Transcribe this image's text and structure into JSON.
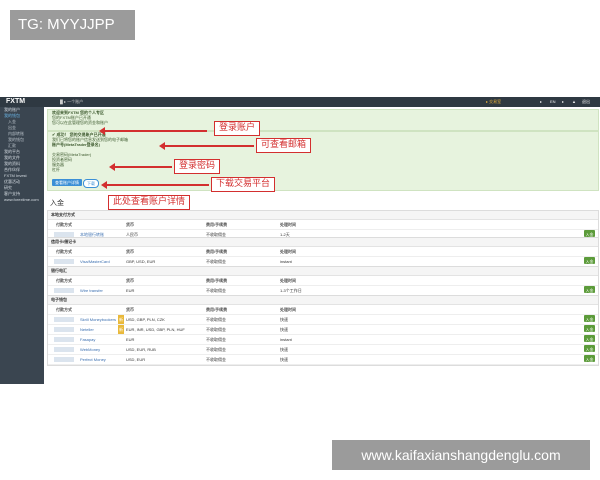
{
  "watermarks": {
    "top_left": "TG: MYYJJPP",
    "bottom_right": "www.kaifaxianshangdenglu.com"
  },
  "topbar": {
    "logo": "FXTM",
    "account": "█ ▸ 一个账户",
    "right_items": [
      "▸",
      "EN",
      "▸",
      "▲",
      "退出"
    ],
    "live_label": "▸ 交易室"
  },
  "sidebar": {
    "items": [
      {
        "label": "我的账户",
        "active": false,
        "sub": false
      },
      {
        "label": "我的钱包",
        "active": true,
        "sub": false
      },
      {
        "label": "入金",
        "active": false,
        "sub": true
      },
      {
        "label": "出金",
        "active": false,
        "sub": true
      },
      {
        "label": "内部转账",
        "active": false,
        "sub": true
      },
      {
        "label": "我的钱包",
        "active": false,
        "sub": true
      },
      {
        "label": "汇款",
        "active": false,
        "sub": true
      },
      {
        "label": "我的平台",
        "active": false,
        "sub": false
      },
      {
        "label": "我的文件",
        "active": false,
        "sub": false
      },
      {
        "label": "我的资料",
        "active": false,
        "sub": false
      },
      {
        "label": "合作伙伴",
        "active": false,
        "sub": false
      },
      {
        "label": "FXTM Invest",
        "active": false,
        "sub": false
      },
      {
        "label": "优惠活动",
        "active": false,
        "sub": false
      },
      {
        "label": "研究",
        "active": false,
        "sub": false
      },
      {
        "label": "客户支持",
        "active": false,
        "sub": false
      },
      {
        "label": "www.forextime.com",
        "active": false,
        "sub": false
      }
    ]
  },
  "notice1": {
    "lines": [
      "欢迎来到FXTM 您的个人专区",
      "您的FXTM账户已开通",
      "您可以在此管理您的资金和账户"
    ]
  },
  "notice2": {
    "lines": [
      "✔ 成功！ 您的交易账户已开通",
      "我们已将您的账户信息发送到您的电子邮箱",
      "账户号(MetaTrader登录名)",
      "  ",
      "交易密码(MetaTrader)",
      "投资者密码",
      "服务器",
      "杠杆"
    ],
    "btn_detail": "查看账户详情",
    "btn_download": "下载"
  },
  "annotations": [
    {
      "text": "登录账户"
    },
    {
      "text": "可查看邮箱"
    },
    {
      "text": "登录密码"
    },
    {
      "text": "下载交易平台"
    },
    {
      "text": "此处查看账户详情"
    }
  ],
  "page_title": "入金",
  "headers": {
    "method": "付款方式",
    "currency": "货币",
    "fee": "费用/手续费",
    "time": "处理时间"
  },
  "groups": [
    {
      "title": "本地支付方式",
      "rows": [
        {
          "method": "本地银行转账",
          "currency": "人民币",
          "fee": "不收取佣金",
          "time": "1-2天",
          "badge": ""
        }
      ]
    },
    {
      "title": "信用卡/借记卡",
      "rows": [
        {
          "method": "Visa/MasterCard",
          "currency": "GBP, USD, EUR",
          "fee": "不收取佣金",
          "time": "instant",
          "badge": ""
        }
      ]
    },
    {
      "title": "银行电汇",
      "rows": [
        {
          "method": "Wire transfer",
          "currency": "EUR",
          "fee": "不收取佣金",
          "time": "1-3个工作日",
          "badge": ""
        }
      ]
    },
    {
      "title": "电子钱包",
      "rows": [
        {
          "method": "Skrill Moneybookers",
          "currency": "USD, GBP, PLN, CZK",
          "fee": "不收取佣金",
          "time": "快速",
          "badge": "新"
        },
        {
          "method": "Neteller",
          "currency": "EUR, INR, USD, GBP, PLN, HUF",
          "fee": "不收取佣金",
          "time": "快速",
          "badge": "新"
        },
        {
          "method": "Fasapay",
          "currency": "EUR",
          "fee": "不收取佣金",
          "time": "instant",
          "badge": ""
        },
        {
          "method": "WebMoney",
          "currency": "USD, EUR, RUB",
          "fee": "不收取佣金",
          "time": "快速",
          "badge": ""
        },
        {
          "method": "Perfect Money",
          "currency": "USD, EUR",
          "fee": "不收取佣金",
          "time": "快速",
          "badge": ""
        }
      ]
    }
  ],
  "add_label": "入金",
  "colors": {
    "sidebar": "#3a4550",
    "topbar": "#2f3942",
    "notice_bg": "#e7f3de",
    "annotation": "#d32f2f",
    "add_button": "#5c9b3a"
  }
}
